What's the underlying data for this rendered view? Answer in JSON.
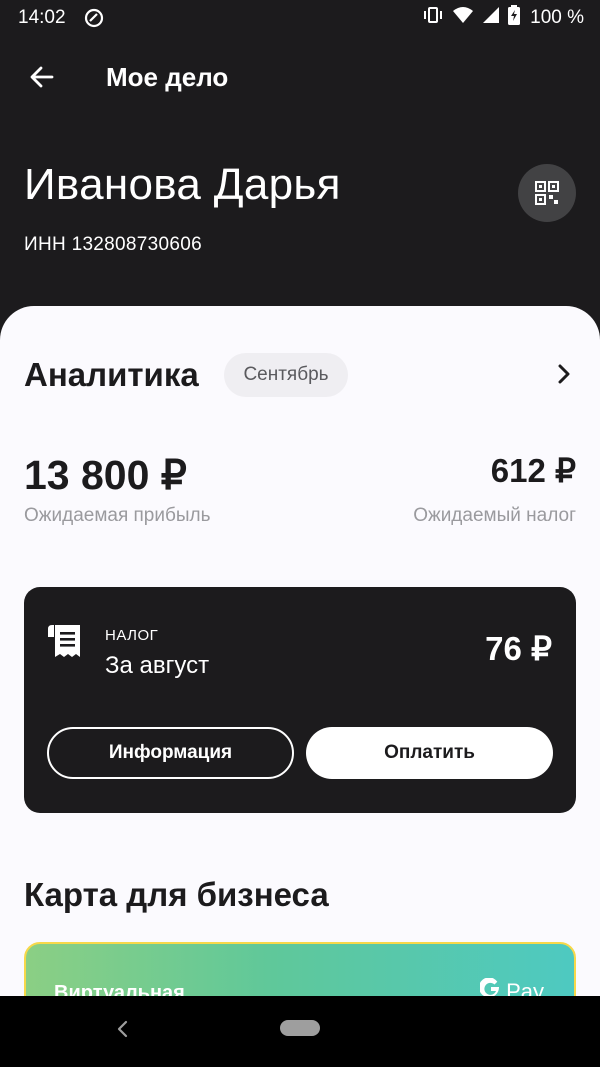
{
  "status_bar": {
    "time": "14:02",
    "battery": "100 %",
    "icons": [
      "at-sign-icon",
      "vibrate-icon",
      "wifi-icon",
      "signal-icon",
      "battery-icon"
    ]
  },
  "app_bar": {
    "title": "Мое дело",
    "back_icon": "arrow-back-icon"
  },
  "profile": {
    "name": "Иванова Дарья",
    "inn": "ИНН 132808730606",
    "qr_icon": "qr-code-icon"
  },
  "analytics": {
    "title": "Аналитика",
    "month": "Сентябрь",
    "expected_profit_value": "13 800 ₽",
    "expected_profit_label": "Ожидаемая прибыль",
    "expected_tax_value": "612 ₽",
    "expected_tax_label": "Ожидаемый налог"
  },
  "tax_card": {
    "overline": "НАЛОГ",
    "title": "За август",
    "amount": "76 ₽",
    "info_button": "Информация",
    "pay_button": "Оплатить"
  },
  "business_card": {
    "section_title": "Карта для бизнеса",
    "type": "Виртуальная",
    "wallet": "Pay"
  },
  "colors": {
    "dark_background": "#1c1b1d",
    "sheet_background": "#fbfafe",
    "muted_text": "#9a9a9e"
  }
}
